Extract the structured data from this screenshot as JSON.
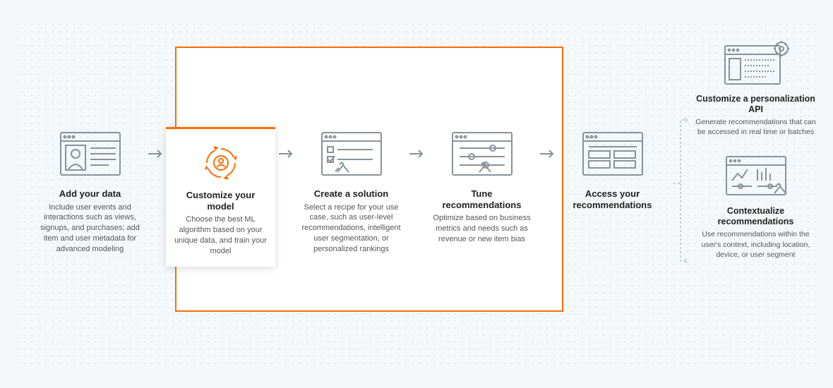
{
  "steps": [
    {
      "title": "Add your data",
      "desc": "Include user events and interactions such as views, signups, and purchases; add item and user metadata for advanced modeling",
      "icon": "profile"
    },
    {
      "title": "Customize your model",
      "desc": "Choose the best ML algorithm based on your unique data, and train your model",
      "icon": "sync-user",
      "highlight": true
    },
    {
      "title": "Create a solution",
      "desc": "Select a recipe for your use case, such as user-level recommendations, intelligent user segmentation, or personalized rankings",
      "icon": "checklist"
    },
    {
      "title": "Tune recommendations",
      "desc": "Optimize based on business metrics and needs such as revenue or new item bias",
      "icon": "sliders"
    },
    {
      "title": "Access your recommendations",
      "desc": "",
      "icon": "grid"
    }
  ],
  "outputs": [
    {
      "title": "Customize a personalization API",
      "desc": "Generate recommendations that can be accessed in real time or batches",
      "icon": "api-gear"
    },
    {
      "title": "Contextualize recommendations",
      "desc": "Use recommendations within the user's context, including location, device, or user segment",
      "icon": "dashboard"
    }
  ],
  "colors": {
    "accent": "#ff6d00",
    "icon": "#8a9299"
  },
  "chart_data": {
    "type": "diagram",
    "title": "ML personalization workflow",
    "nodes": [
      {
        "id": "add-data",
        "label": "Add your data"
      },
      {
        "id": "customize-model",
        "label": "Customize your model",
        "highlighted": true
      },
      {
        "id": "create-solution",
        "label": "Create a solution"
      },
      {
        "id": "tune",
        "label": "Tune recommendations"
      },
      {
        "id": "access",
        "label": "Access your recommendations"
      },
      {
        "id": "api",
        "label": "Customize a personalization API"
      },
      {
        "id": "contextualize",
        "label": "Contextualize recommendations"
      }
    ],
    "edges": [
      [
        "add-data",
        "customize-model"
      ],
      [
        "customize-model",
        "create-solution"
      ],
      [
        "create-solution",
        "tune"
      ],
      [
        "tune",
        "access"
      ],
      [
        "access",
        "api"
      ],
      [
        "access",
        "contextualize"
      ]
    ],
    "grouped_in_frame": [
      "customize-model",
      "create-solution",
      "tune"
    ]
  }
}
